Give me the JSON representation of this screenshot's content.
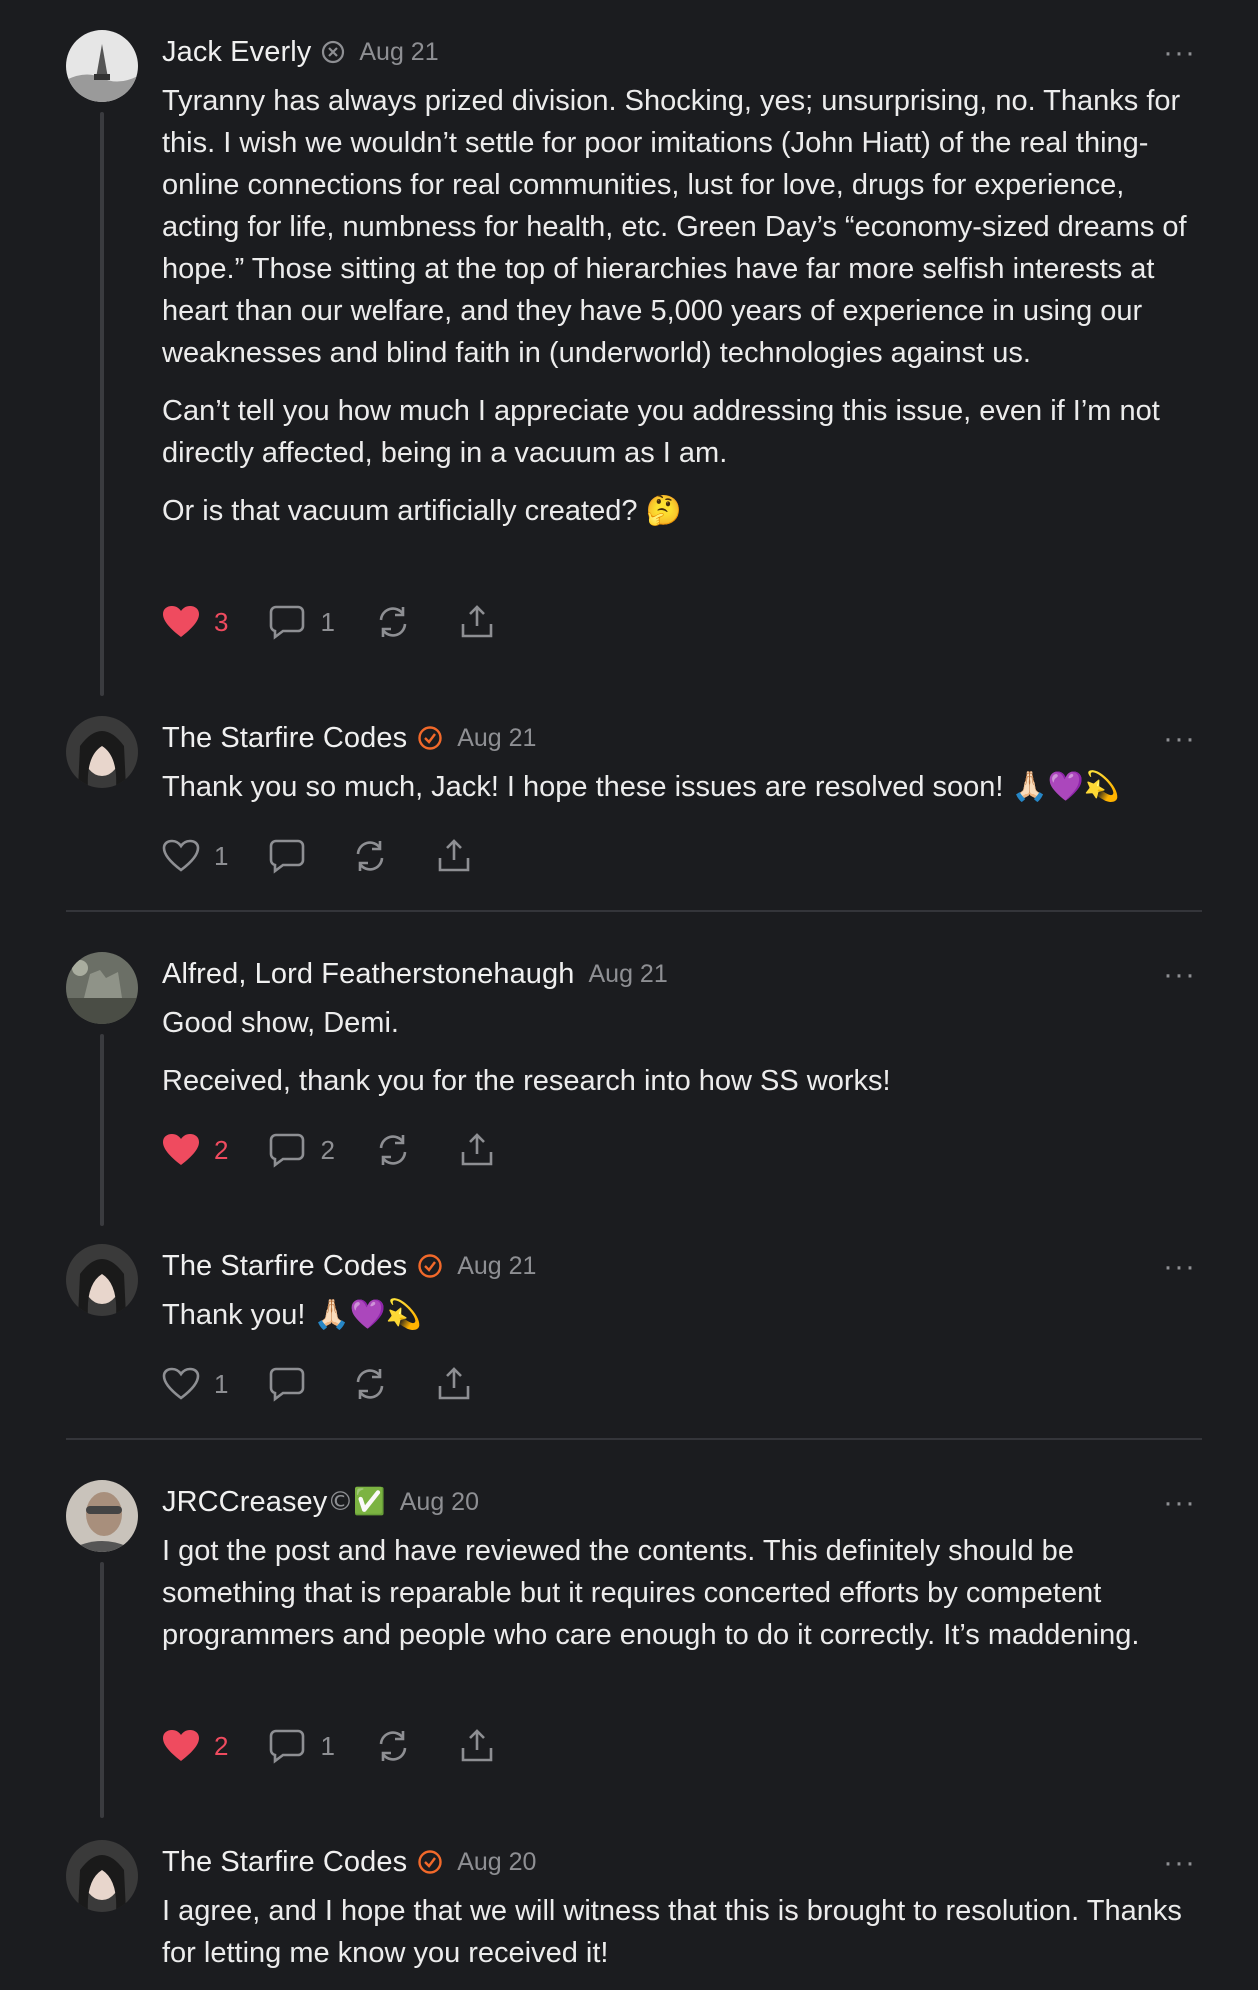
{
  "colors": {
    "background": "#1b1c1f",
    "like_active": "#ef4b5f",
    "muted": "#8e8f93",
    "verified_badge": "#f2692a",
    "check_badge": "#3bb54a"
  },
  "comments": [
    {
      "author": "Jack Everly",
      "badge": "subscriber-badge-icon",
      "date": "Aug 21",
      "paragraphs": [
        "Tyranny has always prized division. Shocking, yes; unsurprising, no. Thanks for this. I wish we wouldn’t settle for poor imitations (John Hiatt) of the real thing-online connections for real communities, lust for love, drugs for experience, acting for life, numbness for health, etc. Green Day’s “economy-sized dreams of hope.” Those sitting at the top of hierarchies have far more selfish interests at heart than our welfare, and they have 5,000 years of experience in using our weaknesses and blind faith in (underworld) technologies against us.",
        "Can’t tell you how much I appreciate you addressing this issue, even if I’m not directly affected, being in a vacuum as I am.",
        "Or is that vacuum artificially created? 🤔"
      ],
      "likes": "3",
      "replies": "1",
      "liked": true
    },
    {
      "author": "The Starfire Codes",
      "badge": "verified-check-icon",
      "date": "Aug 21",
      "paragraphs": [
        "Thank you so much, Jack! I hope these issues are resolved soon! 🙏🏻💜💫"
      ],
      "likes": "1",
      "replies": "",
      "liked": false
    },
    {
      "author": "Alfred, Lord Featherstonehaugh",
      "badge": "",
      "date": "Aug 21",
      "paragraphs": [
        "Good show, Demi.",
        "Received, thank you for the research into how SS works!"
      ],
      "likes": "2",
      "replies": "2",
      "liked": true
    },
    {
      "author": "The Starfire Codes",
      "badge": "verified-check-icon",
      "date": "Aug 21",
      "paragraphs": [
        "Thank you! 🙏🏻💜💫"
      ],
      "likes": "1",
      "replies": "",
      "liked": false
    },
    {
      "author": "JRCCreasey",
      "badge_suffix": "©✅",
      "date": "Aug 20",
      "paragraphs": [
        "I got the post and have reviewed the contents. This definitely should be something that is reparable but it requires concerted efforts by competent programmers and people who care enough to do it correctly. It’s maddening."
      ],
      "likes": "2",
      "replies": "1",
      "liked": true
    },
    {
      "author": "The Starfire Codes",
      "badge": "verified-check-icon",
      "date": "Aug 20",
      "paragraphs": [
        "I agree, and I hope that we will witness that this is brought to resolution. Thanks for letting me know you received it!"
      ],
      "likes": "",
      "replies": "",
      "liked": false
    }
  ],
  "more_glyph": "···"
}
